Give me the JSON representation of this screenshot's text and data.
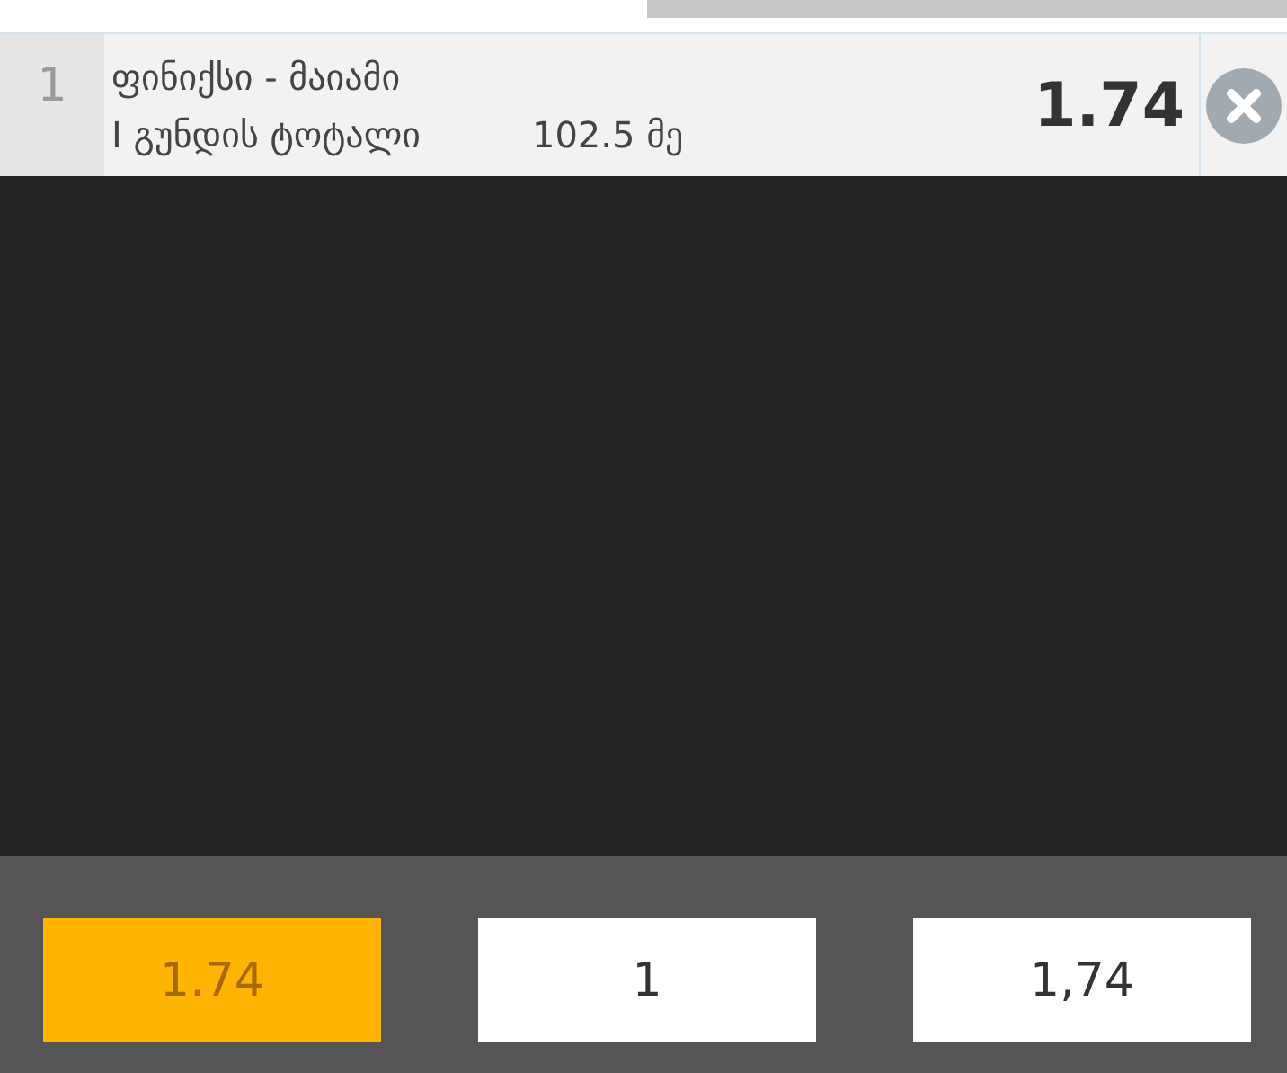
{
  "bet": {
    "index": "1",
    "match": "ფინიქსი - მაიამი",
    "market": "I გუნდის ტოტალი",
    "selection": "102.5 მე",
    "odds": "1.74"
  },
  "stake_buttons": [
    {
      "label": "1.74",
      "selected": true
    },
    {
      "label": "1",
      "selected": false
    },
    {
      "label": "1,74",
      "selected": false
    }
  ]
}
